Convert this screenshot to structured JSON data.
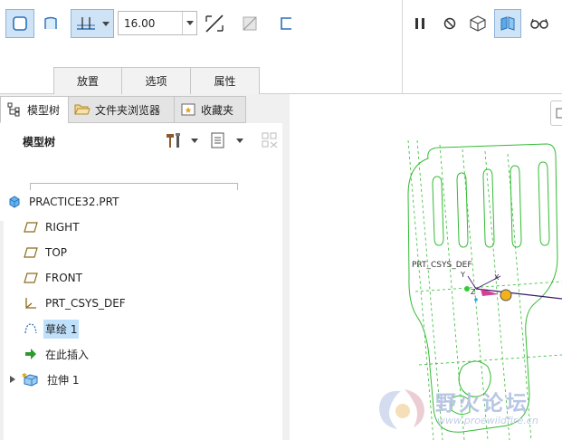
{
  "ribbon": {
    "depth_value": "16.00",
    "dashboard_tabs": [
      "放置",
      "选项",
      "属性"
    ]
  },
  "navigator": {
    "tabs": [
      {
        "label": "模型树",
        "icon": "model-tree-icon",
        "active": true
      },
      {
        "label": "文件夹浏览器",
        "icon": "folder-browser-icon",
        "active": false
      },
      {
        "label": "收藏夹",
        "icon": "favorites-icon",
        "active": false
      }
    ],
    "title": "模型树",
    "filter_placeholder": ""
  },
  "tree": {
    "root": "PRACTICE32.PRT",
    "items": [
      {
        "label": "RIGHT",
        "icon": "datum-plane-icon"
      },
      {
        "label": "TOP",
        "icon": "datum-plane-icon"
      },
      {
        "label": "FRONT",
        "icon": "datum-plane-icon"
      },
      {
        "label": "PRT_CSYS_DEF",
        "icon": "coordinate-system-icon"
      },
      {
        "label": "草绘 1",
        "icon": "sketch-icon"
      },
      {
        "label": "在此插入",
        "icon": "insert-here-arrow-icon"
      },
      {
        "label": "拉伸 1",
        "icon": "extrude-icon"
      }
    ]
  },
  "graphics": {
    "csys_label": "PRT_CSYS_DEF",
    "axis_y": "Y",
    "axis_x": "X",
    "axis_z": "Z"
  },
  "watermark": {
    "title": "野火论坛",
    "url": "www.proewildfire.cn"
  },
  "colors": {
    "geometry": "#33bb33",
    "selection": "#bfe0fb",
    "accent_blue": "#2b6fb8"
  }
}
